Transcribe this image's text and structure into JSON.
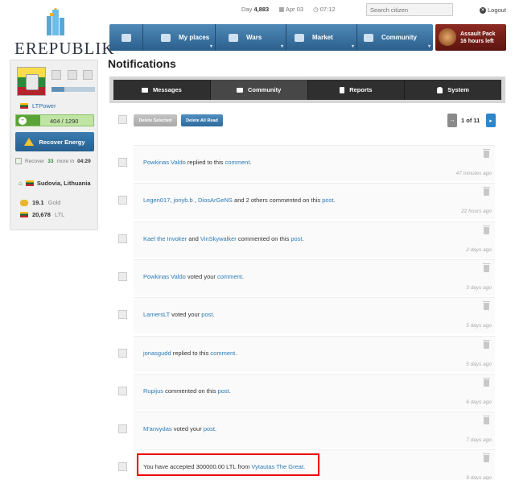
{
  "brand": {
    "name": "EREPUBLIK",
    "registered": "®"
  },
  "topbar": {
    "day_label": "Day",
    "day_value": "4,883",
    "date": "Apr 03",
    "time": "07:12",
    "search_placeholder": "Search citizen",
    "logout": "Logout"
  },
  "nav": {
    "items": [
      {
        "label": "My places"
      },
      {
        "label": "Wars"
      },
      {
        "label": "Market"
      },
      {
        "label": "Community"
      }
    ],
    "assault": {
      "line1": "Assault Pack",
      "line2": "16 hours left"
    }
  },
  "profile": {
    "username": "LTPower",
    "xp_progress": 0.3,
    "energy": "404 / 1290",
    "energy_fraction": 0.31,
    "recover_button": "Recover Energy",
    "recover_prefix": "Recover",
    "recover_amount": "33",
    "recover_mid": "more in",
    "recover_time": "04:29",
    "location": "Sudovia, Lithuania",
    "gold_value": "19.1",
    "gold_unit": "Gold",
    "ltl_value": "20,678",
    "ltl_unit": "LTL"
  },
  "page": {
    "title": "Notifications"
  },
  "tabs": [
    {
      "label": "Messages"
    },
    {
      "label": "Community",
      "active": true
    },
    {
      "label": "Reports"
    },
    {
      "label": "System"
    }
  ],
  "toolbar": {
    "delete_selected": "Delete Selected",
    "delete_all_read": "Delete All Read",
    "page_info": "1 of 11",
    "prev": "→",
    "next": "▸"
  },
  "notifications": [
    {
      "parts": [
        [
          "link",
          "Powkinas Valdo"
        ],
        [
          "text",
          " replied to this "
        ],
        [
          "link",
          "comment"
        ],
        [
          "text",
          "."
        ]
      ],
      "time": "47 minutes ago"
    },
    {
      "parts": [
        [
          "link",
          "Legen017"
        ],
        [
          "text",
          ", "
        ],
        [
          "link",
          "jonyb.b"
        ],
        [
          "text",
          " , "
        ],
        [
          "link",
          "DiosArGeNS"
        ],
        [
          "text",
          " and 2 others commented on this "
        ],
        [
          "link",
          "post"
        ],
        [
          "text",
          "."
        ]
      ],
      "time": "22 hours ago"
    },
    {
      "parts": [
        [
          "link",
          "Kael the Invoker"
        ],
        [
          "text",
          " and "
        ],
        [
          "link",
          "VinSkywalker"
        ],
        [
          "text",
          " commented on this "
        ],
        [
          "link",
          "post"
        ],
        [
          "text",
          "."
        ]
      ],
      "time": "2 days ago"
    },
    {
      "parts": [
        [
          "link",
          "Powkinas Valdo"
        ],
        [
          "text",
          " voted your "
        ],
        [
          "link",
          "comment"
        ],
        [
          "text",
          "."
        ]
      ],
      "time": "3 days ago"
    },
    {
      "parts": [
        [
          "link",
          "LamersLT"
        ],
        [
          "text",
          " voted your "
        ],
        [
          "link",
          "post"
        ],
        [
          "text",
          "."
        ]
      ],
      "time": "5 days ago"
    },
    {
      "parts": [
        [
          "link",
          "jonasgudd"
        ],
        [
          "text",
          " replied to this "
        ],
        [
          "link",
          "comment"
        ],
        [
          "text",
          "."
        ]
      ],
      "time": "5 days ago"
    },
    {
      "parts": [
        [
          "link",
          "Rupijus"
        ],
        [
          "text",
          " commented on this "
        ],
        [
          "link",
          "post"
        ],
        [
          "text",
          "."
        ]
      ],
      "time": "6 days ago"
    },
    {
      "parts": [
        [
          "link",
          "M'anvydas"
        ],
        [
          "text",
          " voted your "
        ],
        [
          "link",
          "post"
        ],
        [
          "text",
          "."
        ]
      ],
      "time": "7 days ago"
    },
    {
      "parts": [
        [
          "text",
          "You have accepted 300000.00 LTL from "
        ],
        [
          "link",
          "Vytautas The Great"
        ],
        [
          "text",
          "."
        ]
      ],
      "time": "9 days ago"
    }
  ]
}
